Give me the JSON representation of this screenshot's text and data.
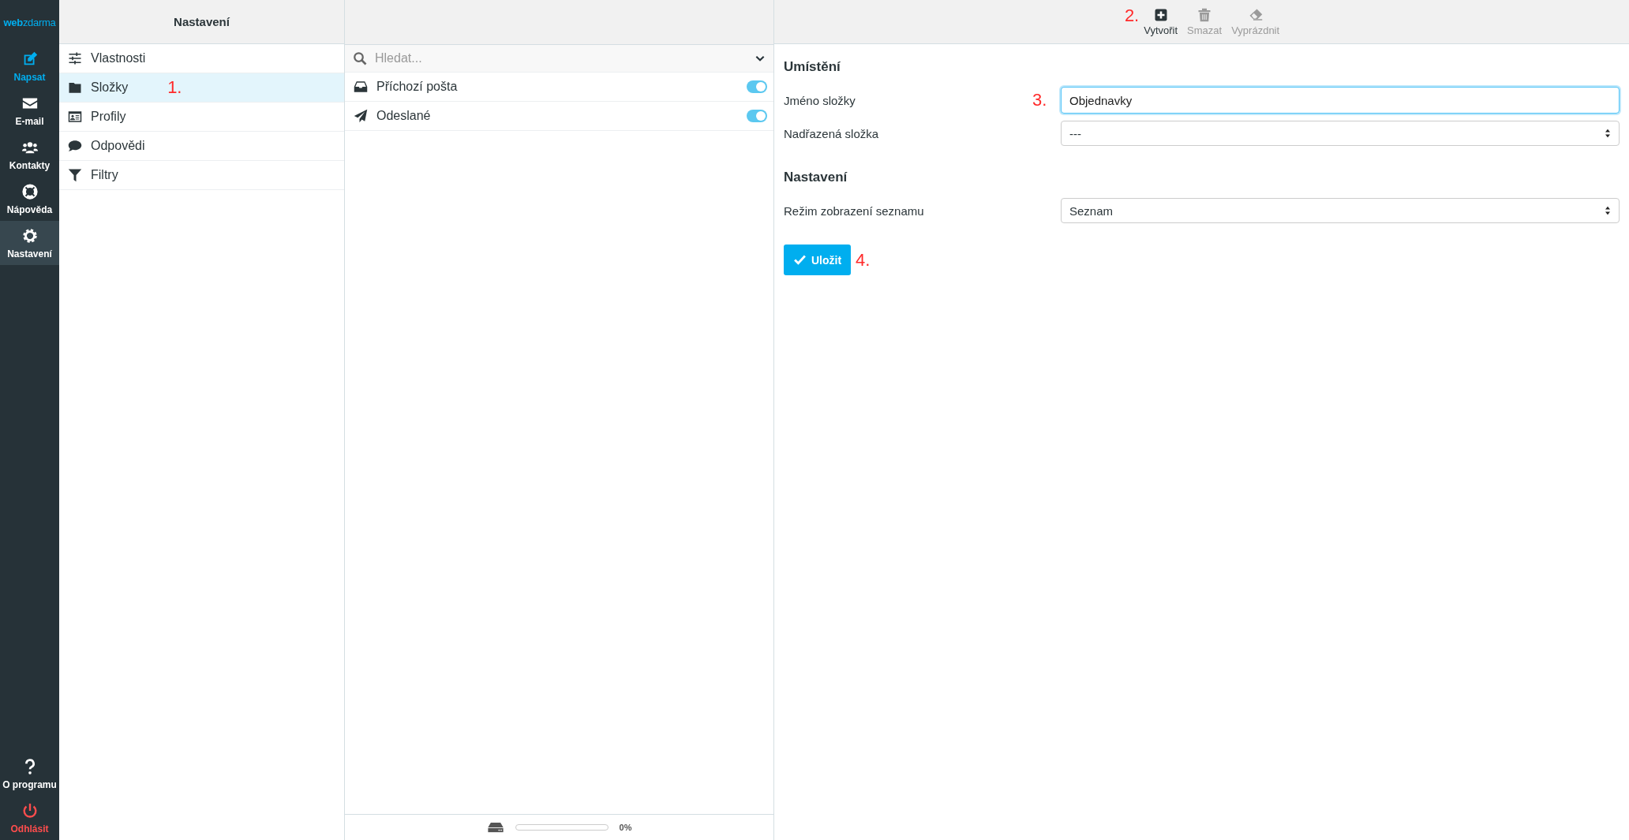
{
  "logo": {
    "part_1": "web",
    "part_2": "zdarma"
  },
  "nav": [
    {
      "label": "Napsat",
      "kind": "action",
      "selected": false
    },
    {
      "label": "E-mail",
      "kind": "section",
      "selected": false
    },
    {
      "label": "Kontakty",
      "kind": "section",
      "selected": false
    },
    {
      "label": "Nápověda",
      "kind": "section",
      "selected": false
    },
    {
      "label": "Nastavení",
      "kind": "section",
      "selected": true
    }
  ],
  "nav_bottom": [
    {
      "label": "O programu",
      "kind": "section"
    },
    {
      "label": "Odhlásit",
      "kind": "logout"
    }
  ],
  "settings": {
    "title": "Nastavení",
    "items": [
      {
        "label": "Vlastnosti",
        "selected": false
      },
      {
        "label": "Složky",
        "selected": true,
        "annotation": "1."
      },
      {
        "label": "Profily",
        "selected": false
      },
      {
        "label": "Odpovědi",
        "selected": false
      },
      {
        "label": "Filtry",
        "selected": false
      }
    ]
  },
  "folders": {
    "search": {
      "placeholder": "Hledat..."
    },
    "items": [
      {
        "label": "Příchozí pošta",
        "on": true
      },
      {
        "label": "Odeslané",
        "on": true
      }
    ],
    "quota": {
      "level": 0,
      "reading": "0%"
    }
  },
  "toolbar": {
    "annotation": "2.",
    "buttons": [
      {
        "label": "Vytvořit",
        "disabled": false
      },
      {
        "label": "Smazat",
        "disabled": true
      },
      {
        "label": "Vyprázdnit",
        "disabled": true
      }
    ]
  },
  "form": {
    "sections": [
      {
        "title": "Umístění",
        "fields": [
          {
            "label": "Jméno složky",
            "kind": "input",
            "value": "Objednavky",
            "focused": true,
            "annotation": "3."
          },
          {
            "label": "Nadřazená složka",
            "kind": "select",
            "value": "---"
          }
        ]
      },
      {
        "title": "Nastavení",
        "fields": [
          {
            "label": "Režim zobrazení seznamu",
            "kind": "select",
            "value": "Seznam"
          }
        ]
      }
    ],
    "save_button": {
      "label": "Uložit",
      "annotation": "4."
    }
  }
}
